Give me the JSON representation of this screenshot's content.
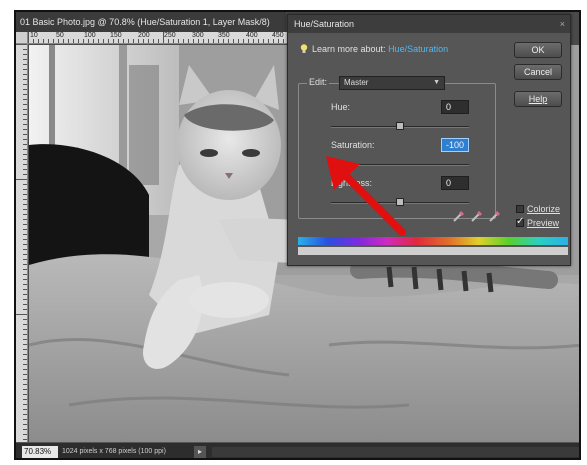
{
  "document": {
    "title": "01 Basic Photo.jpg @ 70.8% (Hue/Saturation 1, Layer Mask/8)",
    "ruler_top_labels": [
      "10",
      "50",
      "100",
      "150",
      "200",
      "250",
      "300",
      "350",
      "400",
      "450"
    ],
    "zoom": "70.83%",
    "doc_info": "1024 pixels x 768 pixels (100 ppi)",
    "status_arrow": "▸"
  },
  "dialog": {
    "title": "Hue/Saturation",
    "close_glyph": "×",
    "learn_prefix": "Learn more about:",
    "learn_link": "Hue/Saturation",
    "ok_label": "OK",
    "cancel_label": "Cancel",
    "help_label": "Help",
    "edit_label": "Edit:",
    "edit_value": "Master",
    "hue": {
      "label": "Hue:",
      "value": "0",
      "slider_fraction": 0.5
    },
    "saturation": {
      "label": "Saturation:",
      "value": "-100",
      "slider_fraction": 0.0
    },
    "lightness": {
      "label": "Lightness:",
      "value": "0",
      "slider_fraction": 0.5
    },
    "colorize_label": "Colorize",
    "colorize_checked": false,
    "preview_label": "Preview",
    "preview_checked": true,
    "eyedroppers": [
      "eyedropper-icon",
      "eyedropper-plus-icon",
      "eyedropper-minus-icon"
    ]
  },
  "colors": {
    "accent_link": "#53b7f0",
    "focused_field": "#2f7fd1",
    "annotation_arrow": "#e01010",
    "spectrum": [
      "#2ab0e8",
      "#2a4fe0",
      "#7a2ae0",
      "#d02ac0",
      "#e02a3a",
      "#e0702a",
      "#e0d02a",
      "#5ad02a",
      "#2ad0c0",
      "#2ab0e8"
    ]
  }
}
